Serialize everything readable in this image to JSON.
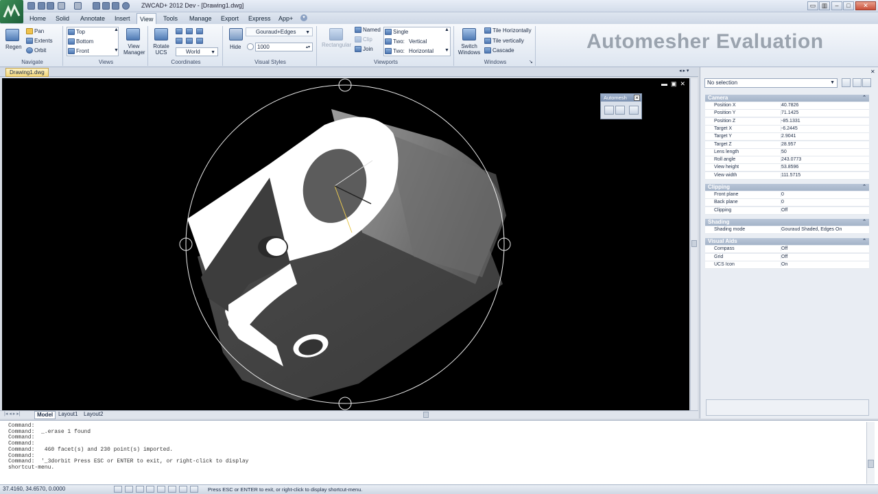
{
  "title_bar": {
    "app_title": "ZWCAD+ 2012 Dev - [Drawing1.dwg]"
  },
  "menu_tabs": [
    "Home",
    "Solid",
    "Annotate",
    "Insert",
    "View",
    "Tools",
    "Manage",
    "Export",
    "Express",
    "App+"
  ],
  "active_tab": "View",
  "ribbon": {
    "navigate": {
      "regen": "Regen",
      "pan": "Pan",
      "extents": "Extents",
      "orbit": "Orbit",
      "label": "Navigate"
    },
    "views": {
      "top": "Top",
      "bottom": "Bottom",
      "front": "Front",
      "view_manager": "View Manager",
      "label": "Views"
    },
    "coordinates": {
      "rotate_ucs": "Rotate UCS",
      "ucs_value": "World",
      "label": "Coordinates"
    },
    "visual_styles": {
      "style_value": "Gouraud+Edges",
      "hide": "Hide",
      "facet_value": "1000",
      "label": "Visual Styles"
    },
    "viewports": {
      "rectangular": "Rectangular",
      "named": "Named",
      "clip": "Clip",
      "join": "Join",
      "single": "Single",
      "two_vertical_prefix": "Two:",
      "two_vertical": "Vertical",
      "two_horizontal_prefix": "Two:",
      "two_horizontal": "Horizontal",
      "label": "Viewports"
    },
    "windows": {
      "switch_windows": "Switch Windows",
      "tile_horizontally": "Tile Horizontally",
      "tile_vertically": "Tile vertically",
      "cascade": "Cascade",
      "label": "Windows"
    },
    "banner": "Automesher Evaluation"
  },
  "document_tab": "Drawing1.dwg",
  "floating_toolbar": {
    "title": "Automesh"
  },
  "layout_tabs": [
    "Model",
    "Layout1",
    "Layout2"
  ],
  "active_layout": "Model",
  "properties": {
    "selection": "No selection",
    "sections": [
      {
        "name": "Camera",
        "rows": [
          {
            "k": "Position X",
            "v": "40.7826"
          },
          {
            "k": "Position Y",
            "v": "71.1425"
          },
          {
            "k": "Position Z",
            "v": "-85.1331"
          },
          {
            "k": "Target X",
            "v": "-6.2445"
          },
          {
            "k": "Target Y",
            "v": "2.9041"
          },
          {
            "k": "Target Z",
            "v": "28.957"
          },
          {
            "k": "Lens length",
            "v": "50"
          },
          {
            "k": "Roll angle",
            "v": "243.0773"
          },
          {
            "k": "View height",
            "v": "53.8596"
          },
          {
            "k": "View width",
            "v": "111.5715"
          }
        ]
      },
      {
        "name": "Clipping",
        "rows": [
          {
            "k": "Front plane",
            "v": "0"
          },
          {
            "k": "Back plane",
            "v": "0"
          },
          {
            "k": "Clipping",
            "v": "Off"
          }
        ]
      },
      {
        "name": "Shading",
        "rows": [
          {
            "k": "Shading mode",
            "v": "Gouraud Shaded, Edges On"
          }
        ]
      },
      {
        "name": "Visual Aids",
        "rows": [
          {
            "k": "Compass",
            "v": "Off"
          },
          {
            "k": "Grid",
            "v": "Off"
          },
          {
            "k": "UCS Icon",
            "v": "On"
          }
        ]
      }
    ]
  },
  "command_lines": [
    "Command:",
    "Command:  _.erase 1 found",
    "Command:",
    "Command:",
    "Command:   460 facet(s) and 230 point(s) imported.",
    "Command:",
    "Command:  '_3dorbit Press ESC or ENTER to exit, or right-click to display",
    "shortcut-menu."
  ],
  "status": {
    "coords": "37.4160, 34.6570, 0.0000",
    "message": "Press ESC or ENTER to exit, or right-click to display shortcut-menu."
  },
  "colors": {
    "viewport_bg": "#000000",
    "ribbon_bg": "#e6ecf4",
    "accent": "#4d76b0",
    "banner": "#9aa3ae"
  }
}
